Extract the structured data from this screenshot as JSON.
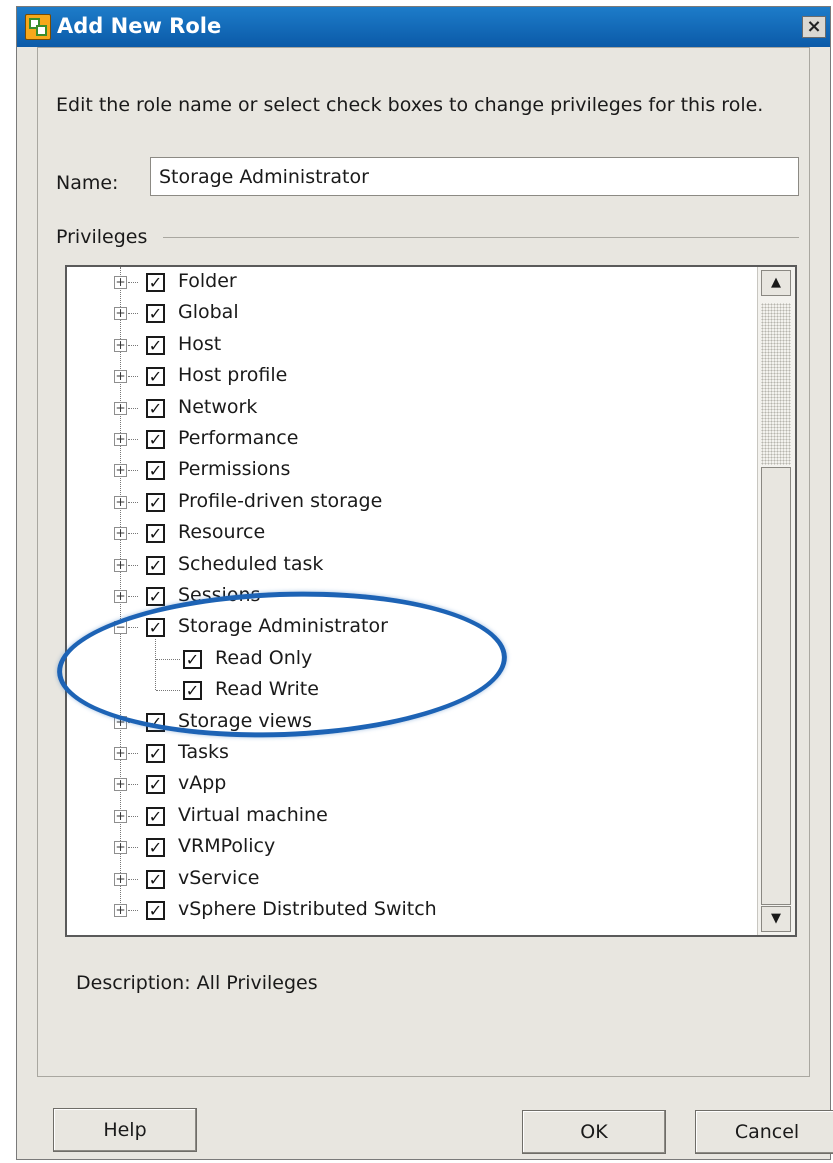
{
  "window": {
    "title": "Add New Role",
    "close_label": "×"
  },
  "intro": "Edit the role name or select check boxes to change privileges for this role.",
  "name_field": {
    "label": "Name:",
    "value": "Storage Administrator"
  },
  "privileges": {
    "label": "Privileges",
    "tree": [
      {
        "label": "Folder",
        "checked": true,
        "expanded": false
      },
      {
        "label": "Global",
        "checked": true,
        "expanded": false
      },
      {
        "label": "Host",
        "checked": true,
        "expanded": false
      },
      {
        "label": "Host profile",
        "checked": true,
        "expanded": false
      },
      {
        "label": "Network",
        "checked": true,
        "expanded": false
      },
      {
        "label": "Performance",
        "checked": true,
        "expanded": false
      },
      {
        "label": "Permissions",
        "checked": true,
        "expanded": false
      },
      {
        "label": "Profile-driven storage",
        "checked": true,
        "expanded": false
      },
      {
        "label": "Resource",
        "checked": true,
        "expanded": false
      },
      {
        "label": "Scheduled task",
        "checked": true,
        "expanded": false
      },
      {
        "label": "Sessions",
        "checked": true,
        "expanded": false
      },
      {
        "label": "Storage Administrator",
        "checked": true,
        "expanded": true,
        "children": [
          {
            "label": "Read Only",
            "checked": true
          },
          {
            "label": "Read Write",
            "checked": true
          }
        ]
      },
      {
        "label": "Storage views",
        "checked": true,
        "expanded": false
      },
      {
        "label": "Tasks",
        "checked": true,
        "expanded": false
      },
      {
        "label": "vApp",
        "checked": true,
        "expanded": false
      },
      {
        "label": "Virtual machine",
        "checked": true,
        "expanded": false
      },
      {
        "label": "VRMPolicy",
        "checked": true,
        "expanded": false
      },
      {
        "label": "vService",
        "checked": true,
        "expanded": false
      },
      {
        "label": "vSphere Distributed Switch",
        "checked": true,
        "expanded": false
      }
    ]
  },
  "description": {
    "label": "Description:",
    "value": "All Privileges"
  },
  "buttons": {
    "help": "Help",
    "ok": "OK",
    "cancel": "Cancel"
  },
  "icons": {
    "window": "role-icon",
    "close": "close-icon",
    "scroll_up": "scroll-up-arrow-icon",
    "scroll_down": "scroll-down-arrow-icon",
    "check": "checkmark-icon",
    "expand": "plus-icon",
    "collapse": "minus-icon"
  },
  "colors": {
    "titlebar": "#0b5aa8",
    "highlight": "#1d63b5"
  }
}
